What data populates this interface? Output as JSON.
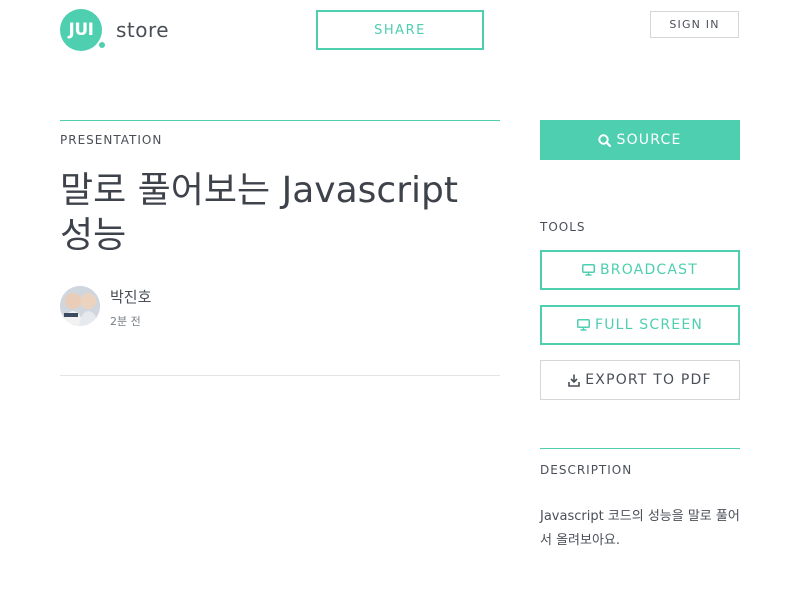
{
  "brand": {
    "logo_mark": "JUI",
    "logo_text": "store",
    "accent_color": "#4ecfb0"
  },
  "header": {
    "share_label": "SHARE",
    "signin_label": "SIGN IN"
  },
  "presentation": {
    "category": "PRESENTATION",
    "title": "말로 풀어보는 Javascript 성능",
    "author_name": "박진호",
    "posted_time": "2분 전"
  },
  "sidebar": {
    "source_label": "SOURCE",
    "source_icon": "search-icon",
    "tools_heading": "TOOLS",
    "broadcast_label": "BROADCAST",
    "broadcast_icon": "monitor-icon",
    "fullscreen_label": "FULL SCREEN",
    "fullscreen_icon": "monitor-icon",
    "export_label": "EXPORT TO PDF",
    "export_icon": "download-icon",
    "description_heading": "DESCRIPTION",
    "description_text": "Javascript 코드의 성능을 말로 풀어서 올려보아요."
  }
}
